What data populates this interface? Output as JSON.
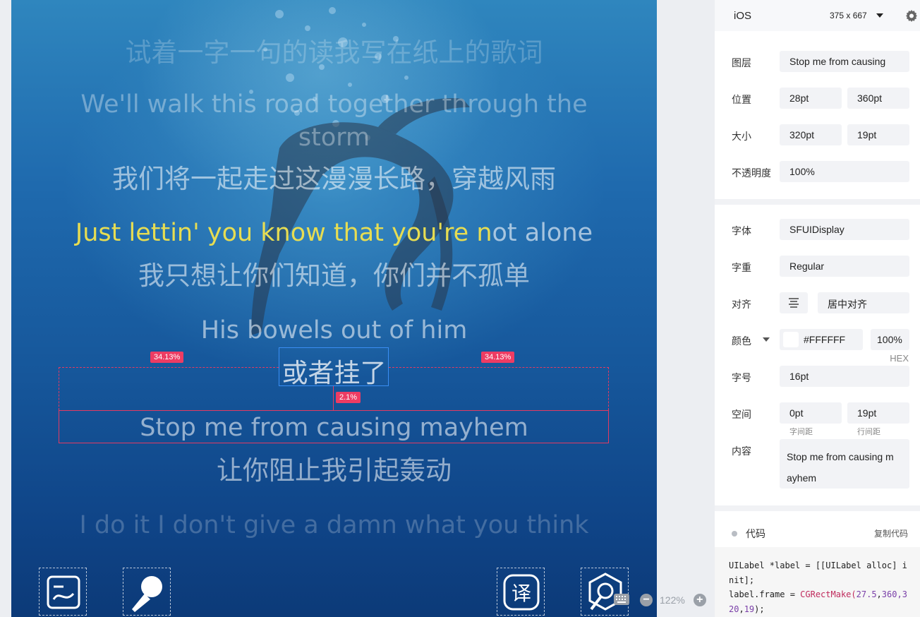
{
  "lyrics": {
    "line0_cn": "试着一字一句的读我写在纸上的歌词",
    "line1_en_a": "We'll walk this road together through the",
    "line1_en_b": "storm",
    "line1_cn": "我们将一起走过这漫漫长路，穿越风雨",
    "line2_en_hl": "Just lettin' you know that you're n",
    "line2_en_rest": "ot alone",
    "line2_cn": "我只想让你们知道，你们并不孤单",
    "line3_en": "His bowels out of him",
    "line3_cn": "或者挂了",
    "line4_en": "Stop me from causing mayhem",
    "line4_cn": "让你阻止我引起轰动",
    "line5_en": "I do it I don't give a damn what you think"
  },
  "measure": {
    "left_pct": "34.13%",
    "right_pct": "34.13%",
    "gap_pct": "2.1%"
  },
  "controls": [
    "image-icon",
    "microphone-icon",
    "translate-icon",
    "search-icon"
  ],
  "controls_text": {
    "translate_glyph": "译"
  },
  "zoom": {
    "minus": "−",
    "value": "122%",
    "plus": "+"
  },
  "panel": {
    "platform": "iOS",
    "device_size": "375 x 667",
    "layer_label": "图层",
    "layer_value": "Stop me from causing",
    "position_label": "位置",
    "position_x": "28pt",
    "position_y": "360pt",
    "size_label": "大小",
    "size_w": "320pt",
    "size_h": "19pt",
    "opacity_label": "不透明度",
    "opacity_value": "100%",
    "font_label": "字体",
    "font_value": "SFUIDisplay",
    "weight_label": "字重",
    "weight_value": "Regular",
    "align_label": "对齐",
    "align_value": "居中对齐",
    "color_label": "颜色",
    "color_hex": "#FFFFFF",
    "color_swatch": "#ffffff",
    "color_alpha": "100%",
    "color_mode": "HEX",
    "fontsize_label": "字号",
    "fontsize_value": "16pt",
    "spacing_label": "空间",
    "letter_spacing": "0pt",
    "line_spacing": "19pt",
    "letter_spacing_caption": "字间距",
    "line_spacing_caption": "行间距",
    "content_label": "内容",
    "content_line1": "Stop me from causing m",
    "content_line2": "ayhem",
    "code_title": "代码",
    "copy_code": "复制代码"
  },
  "code": {
    "l1a": "UILabel ",
    "l1b": "*label",
    "l1c": " = [[UILabel alloc] i",
    "l2": "nit];",
    "l3a": "label.frame = ",
    "l3b": "CGRectMake(",
    "l3c": "27.5",
    "l3d": ",",
    "l3e": "360",
    "l3f": ",3",
    "l4a": "20",
    "l4b": ",",
    "l4c": "19",
    "l4d": ");"
  },
  "colors": {
    "highlight": "#e7dd52",
    "measure": "#ee3c63",
    "selection": "#3a8ef3"
  }
}
